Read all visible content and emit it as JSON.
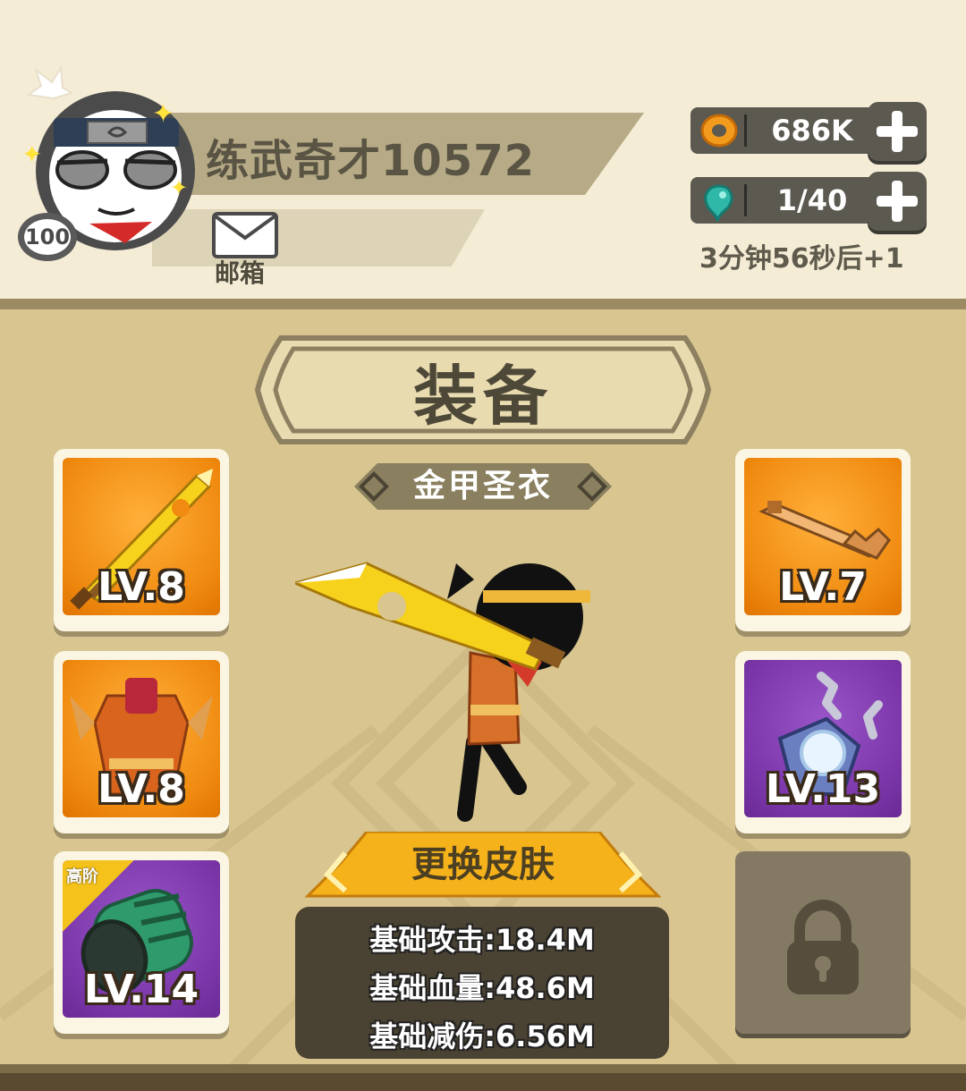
{
  "player": {
    "name": "练武奇才10572",
    "level": "100"
  },
  "mail": {
    "label": "邮箱"
  },
  "resources": {
    "coins": "686K",
    "energy": "1/40",
    "regen_text": "3分钟56秒后+1"
  },
  "panel": {
    "title": "装备",
    "subtitle": "金甲圣衣"
  },
  "slots": [
    {
      "item": "sword",
      "level": "LV.8"
    },
    {
      "item": "armor",
      "level": "LV.8"
    },
    {
      "item": "bracer",
      "level": "LV.14",
      "tier": "高阶"
    },
    {
      "item": "key-staff",
      "level": "LV.7"
    },
    {
      "item": "amulet",
      "level": "LV.13"
    }
  ],
  "skin_button": {
    "label": "更换皮肤"
  },
  "stats": [
    "基础攻击:18.4M",
    "基础血量:48.6M",
    "基础减伤:6.56M"
  ],
  "colors": {
    "header_bg": "#f5ecd6",
    "panel_bg": "#d8c58f",
    "orange_slot": "#f08a10",
    "purple_slot": "#7a36a8",
    "button_gold": "#f5b21b",
    "stats_bg": "#4a4232"
  }
}
